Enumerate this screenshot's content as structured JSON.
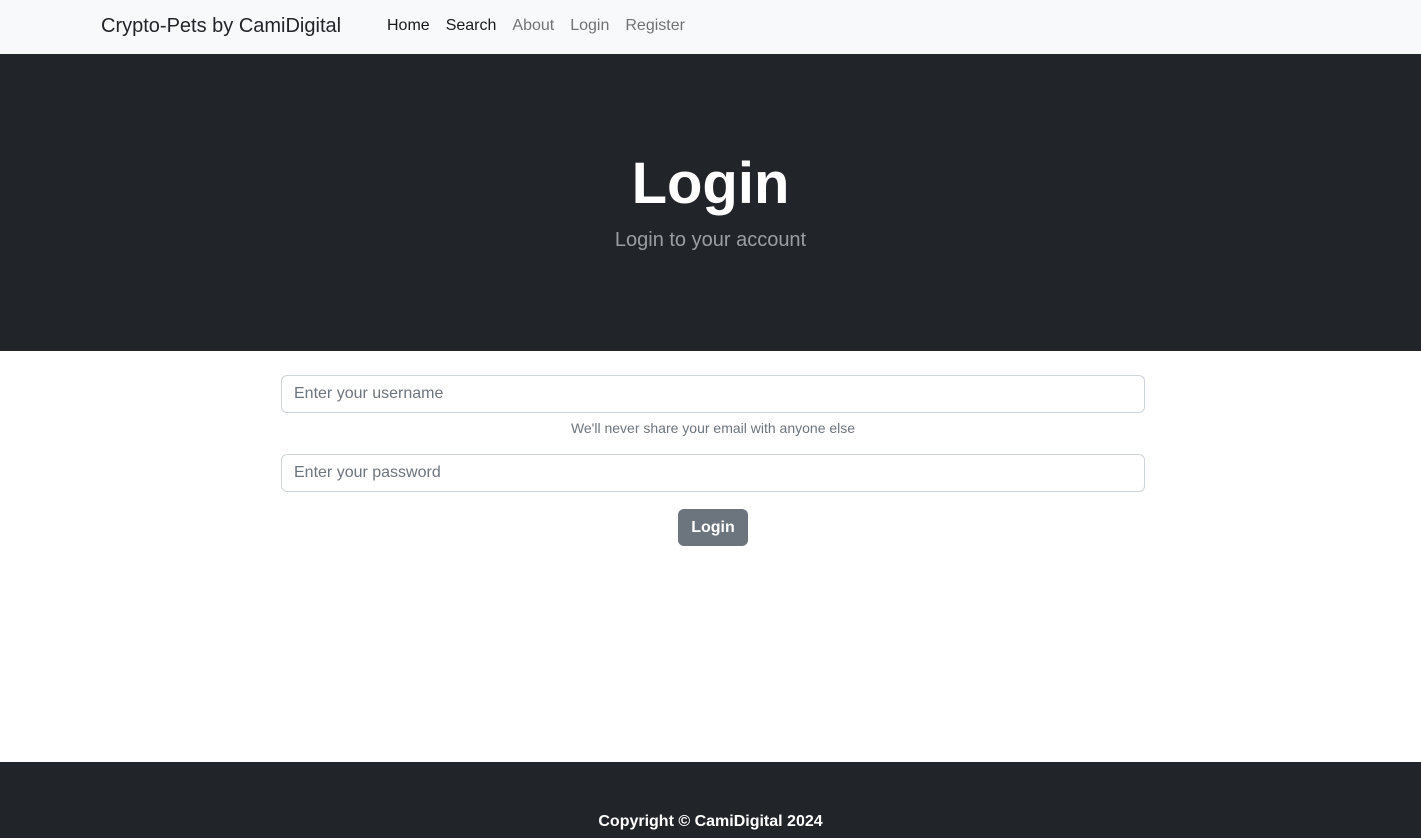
{
  "navbar": {
    "brand": "Crypto-Pets by CamiDigital",
    "links": [
      {
        "label": "Home",
        "active": true
      },
      {
        "label": "Search",
        "active": true
      },
      {
        "label": "About",
        "active": false
      },
      {
        "label": "Login",
        "active": false
      },
      {
        "label": "Register",
        "active": false
      }
    ]
  },
  "hero": {
    "title": "Login",
    "subtitle": "Login to your account"
  },
  "form": {
    "username_placeholder": "Enter your username",
    "username_value": "",
    "help_text": "We'll never share your email with anyone else",
    "password_placeholder": "Enter your password",
    "password_value": "",
    "submit_label": "Login"
  },
  "footer": {
    "copyright": "Copyright © CamiDigital 2024"
  },
  "colors": {
    "navbar_bg": "#f8f9fa",
    "dark_bg": "#212529",
    "button_bg": "#6c757d"
  }
}
